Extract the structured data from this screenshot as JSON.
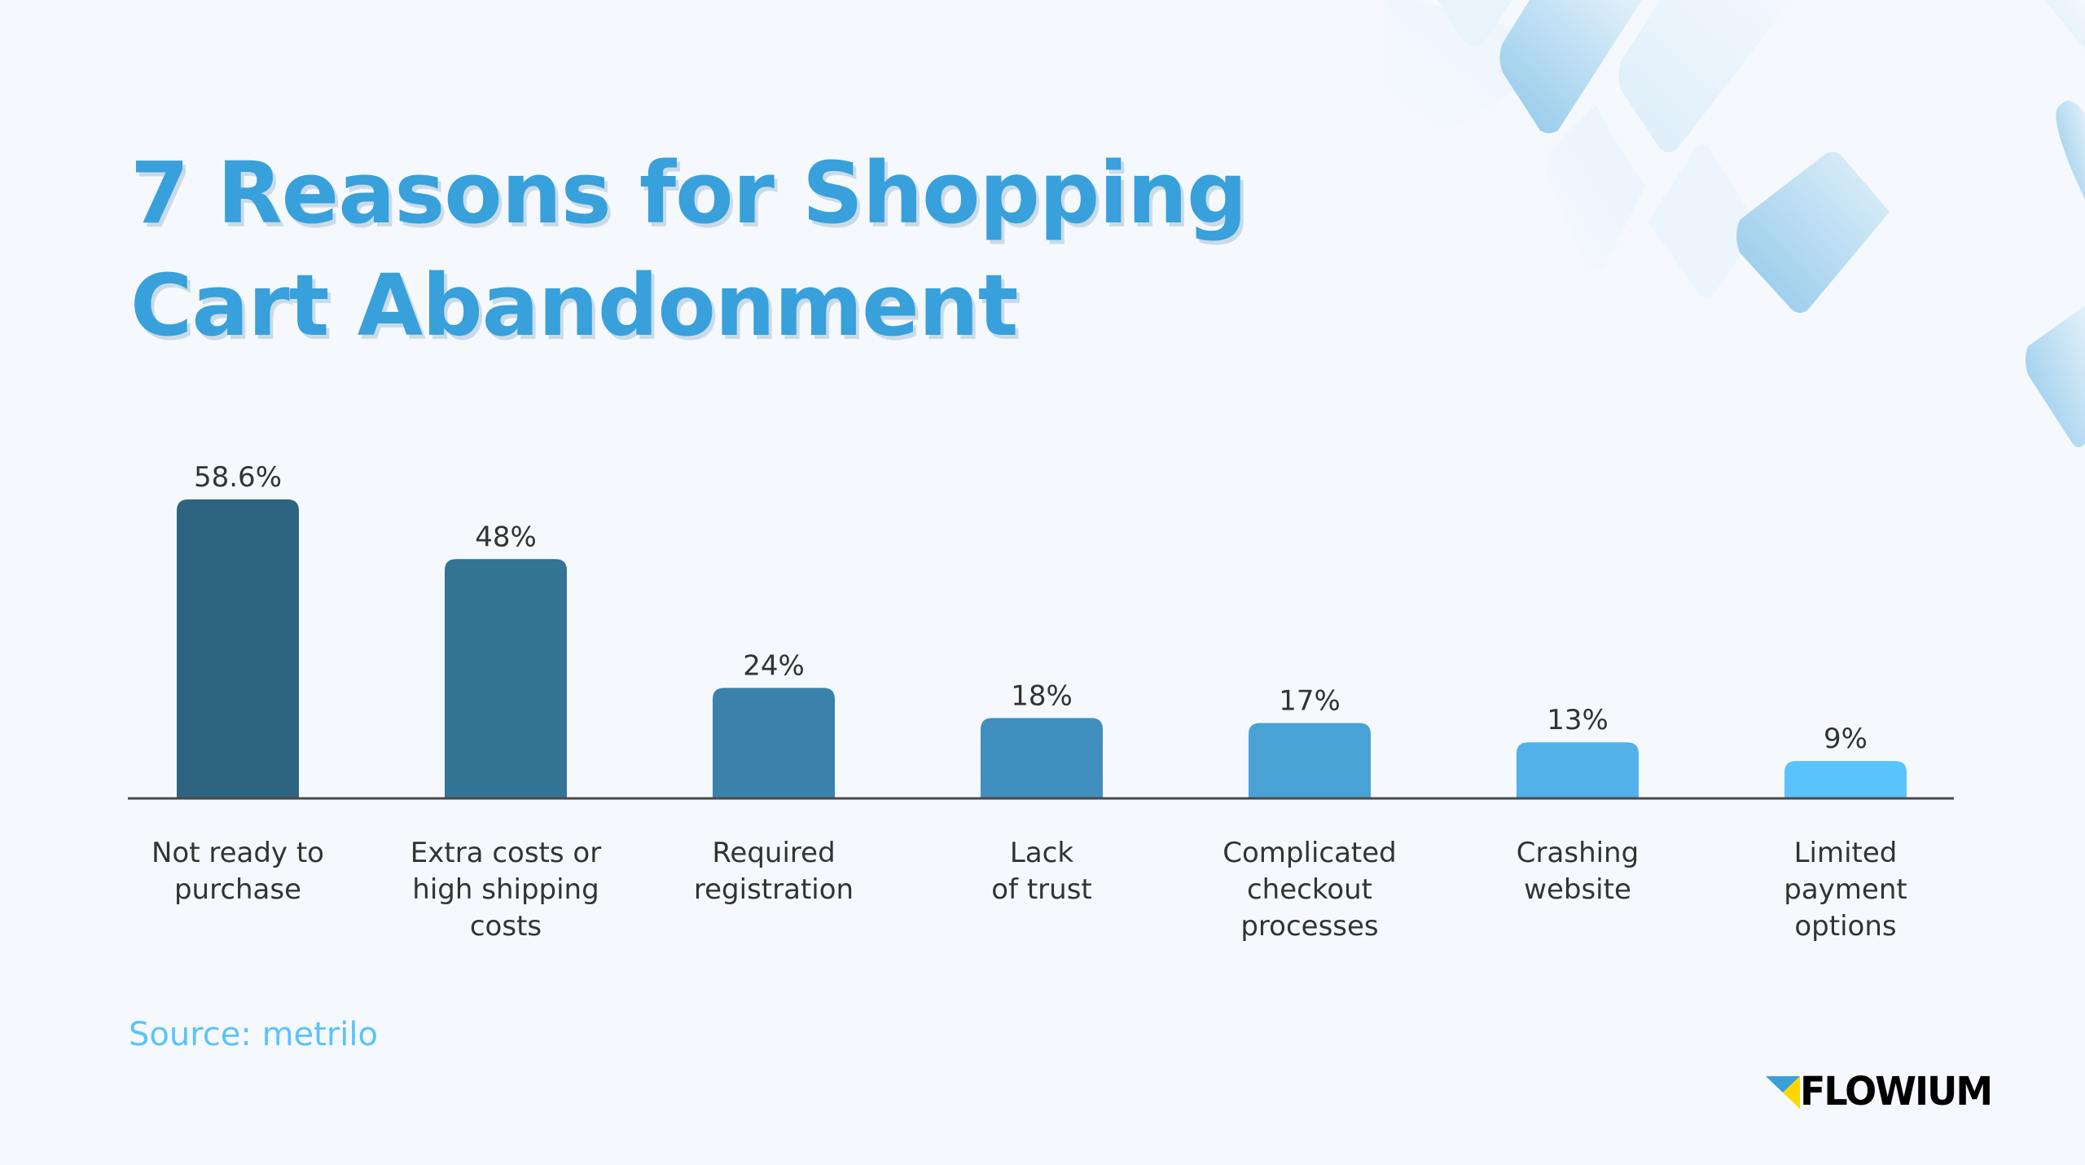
{
  "title_line1": "7 Reasons for Shopping",
  "title_line2": "Cart Abandonment",
  "source": "Source: metrilo",
  "logo": {
    "text": "FLOWIUM",
    "icon": "flowium-triangle-logo-icon",
    "colors": [
      "#3b9fd9",
      "#ffd600"
    ]
  },
  "chart_data": {
    "type": "bar",
    "title": "7 Reasons for Shopping Cart Abandonment",
    "xlabel": "",
    "ylabel": "",
    "ylim": [
      0,
      60
    ],
    "grid": false,
    "categories": [
      [
        "Not ready to",
        "purchase"
      ],
      [
        "Extra costs or",
        "high shipping",
        "costs"
      ],
      [
        "Required",
        "registration"
      ],
      [
        "Lack",
        "of trust"
      ],
      [
        "Complicated",
        "checkout",
        "processes"
      ],
      [
        "Crashing",
        "website"
      ],
      [
        "Limited",
        "payment",
        "options"
      ]
    ],
    "values": [
      58.6,
      48,
      24,
      18,
      17,
      13,
      9
    ],
    "value_labels": [
      "58.6%",
      "48%",
      "24%",
      "18%",
      "17%",
      "13%",
      "9%"
    ],
    "colors": [
      "#2d6480",
      "#347495",
      "#3a82ab",
      "#408fbe",
      "#48a2d6",
      "#52b1e8",
      "#5ac3fd"
    ],
    "source": "metrilo"
  }
}
